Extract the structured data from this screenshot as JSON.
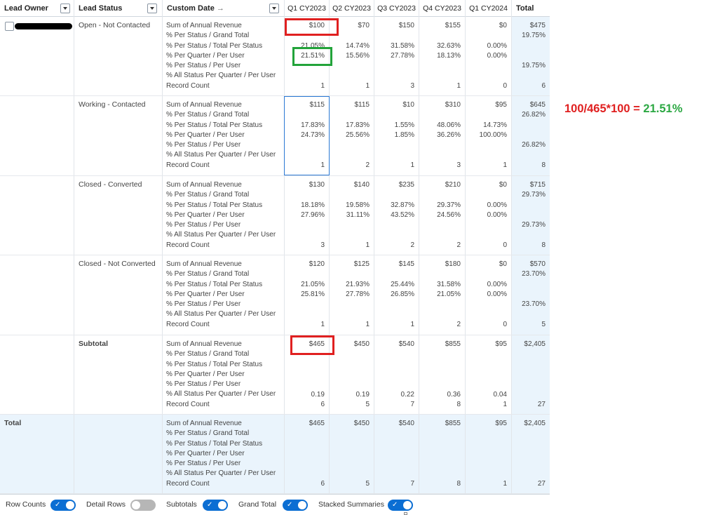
{
  "header": {
    "lead_owner": "Lead Owner",
    "lead_status": "Lead Status",
    "custom_date": "Custom Date",
    "custom_date_arrow": "→",
    "quarters": [
      "Q1 CY2023",
      "Q2 CY2023",
      "Q3 CY2023",
      "Q4 CY2023",
      "Q1 CY2024"
    ],
    "total": "Total"
  },
  "measure_labels": [
    "Sum of Annual Revenue",
    "% Per Status / Grand Total",
    "% Per Status / Total Per Status",
    "% Per Quarter / Per User",
    "% Per Status / Per User",
    "% All Status Per Quarter / Per User",
    "Record Count"
  ],
  "groups": [
    {
      "status": "Open - Not Contacted",
      "quarters": [
        {
          "rev": "$100",
          "tps": "21.05%",
          "ppu": "21.51%",
          "rc": "1"
        },
        {
          "rev": "$70",
          "tps": "14.74%",
          "ppu": "15.56%",
          "rc": "1"
        },
        {
          "rev": "$150",
          "tps": "31.58%",
          "ppu": "27.78%",
          "rc": "3"
        },
        {
          "rev": "$155",
          "tps": "32.63%",
          "ppu": "18.13%",
          "rc": "1"
        },
        {
          "rev": "$0",
          "tps": "0.00%",
          "ppu": "0.00%",
          "rc": "0"
        }
      ],
      "total": {
        "rev": "$475",
        "gt": "19.75%",
        "psu": "19.75%",
        "rc": "6"
      }
    },
    {
      "status": "Working - Contacted",
      "quarters": [
        {
          "rev": "$115",
          "tps": "17.83%",
          "ppu": "24.73%",
          "rc": "1"
        },
        {
          "rev": "$115",
          "tps": "17.83%",
          "ppu": "25.56%",
          "rc": "2"
        },
        {
          "rev": "$10",
          "tps": "1.55%",
          "ppu": "1.85%",
          "rc": "1"
        },
        {
          "rev": "$310",
          "tps": "48.06%",
          "ppu": "36.26%",
          "rc": "3"
        },
        {
          "rev": "$95",
          "tps": "14.73%",
          "ppu": "100.00%",
          "rc": "1"
        }
      ],
      "total": {
        "rev": "$645",
        "gt": "26.82%",
        "psu": "26.82%",
        "rc": "8"
      }
    },
    {
      "status": "Closed - Converted",
      "quarters": [
        {
          "rev": "$130",
          "tps": "18.18%",
          "ppu": "27.96%",
          "rc": "3"
        },
        {
          "rev": "$140",
          "tps": "19.58%",
          "ppu": "31.11%",
          "rc": "1"
        },
        {
          "rev": "$235",
          "tps": "32.87%",
          "ppu": "43.52%",
          "rc": "2"
        },
        {
          "rev": "$210",
          "tps": "29.37%",
          "ppu": "24.56%",
          "rc": "2"
        },
        {
          "rev": "$0",
          "tps": "0.00%",
          "ppu": "0.00%",
          "rc": "0"
        }
      ],
      "total": {
        "rev": "$715",
        "gt": "29.73%",
        "psu": "29.73%",
        "rc": "8"
      }
    },
    {
      "status": "Closed - Not Converted",
      "quarters": [
        {
          "rev": "$120",
          "tps": "21.05%",
          "ppu": "25.81%",
          "rc": "1"
        },
        {
          "rev": "$125",
          "tps": "21.93%",
          "ppu": "27.78%",
          "rc": "1"
        },
        {
          "rev": "$145",
          "tps": "25.44%",
          "ppu": "26.85%",
          "rc": "1"
        },
        {
          "rev": "$180",
          "tps": "31.58%",
          "ppu": "21.05%",
          "rc": "2"
        },
        {
          "rev": "$0",
          "tps": "0.00%",
          "ppu": "0.00%",
          "rc": "0"
        }
      ],
      "total": {
        "rev": "$570",
        "gt": "23.70%",
        "psu": "23.70%",
        "rc": "5"
      }
    }
  ],
  "subtotal": {
    "label": "Subtotal",
    "quarters": [
      {
        "rev": "$465",
        "asq": "0.19",
        "rc": "6"
      },
      {
        "rev": "$450",
        "asq": "0.19",
        "rc": "5"
      },
      {
        "rev": "$540",
        "asq": "0.22",
        "rc": "7"
      },
      {
        "rev": "$855",
        "asq": "0.36",
        "rc": "8"
      },
      {
        "rev": "$95",
        "asq": "0.04",
        "rc": "1"
      }
    ],
    "total": {
      "rev": "$2,405",
      "rc": "27"
    }
  },
  "grand_total": {
    "label": "Total",
    "quarters": [
      {
        "rev": "$465",
        "rc": "6"
      },
      {
        "rev": "$450",
        "rc": "5"
      },
      {
        "rev": "$540",
        "rc": "7"
      },
      {
        "rev": "$855",
        "rc": "8"
      },
      {
        "rev": "$95",
        "rc": "1"
      }
    ],
    "total": {
      "rev": "$2,405",
      "rc": "27"
    }
  },
  "footer": {
    "row_counts": "Row Counts",
    "detail_rows": "Detail Rows",
    "subtotals": "Subtotals",
    "grand_total": "Grand Total",
    "stacked_summaries": "Stacked Summaries",
    "toggles": {
      "row_counts": true,
      "detail_rows": false,
      "subtotals": true,
      "grand_total": true,
      "stacked_summaries": true
    }
  },
  "annotation": {
    "formula": "100/465*100 = ",
    "result": "21.51%"
  },
  "colors": {
    "accent": "#0b6ed3",
    "total_bg": "#eaf4fc",
    "annot_red": "#e02020",
    "annot_green": "#2ca843"
  }
}
